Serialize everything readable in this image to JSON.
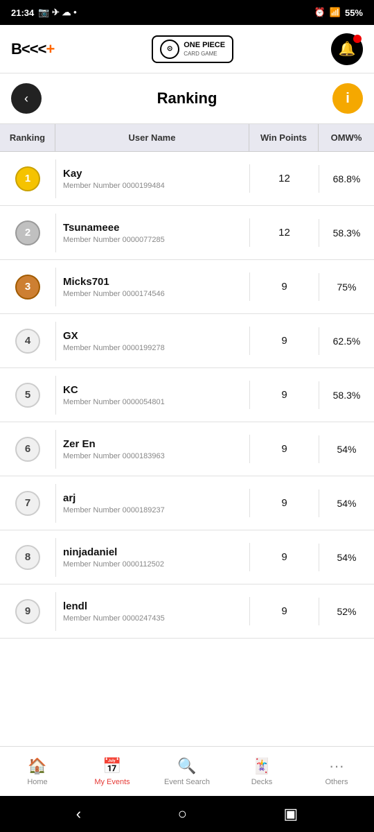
{
  "statusBar": {
    "time": "21:34",
    "battery": "55%",
    "signal": "4G"
  },
  "header": {
    "logoText": "B<<<+",
    "opBrand": "ONE PIECE",
    "opSub": "CARD GAME",
    "bellBadge": true
  },
  "pageHeader": {
    "backLabel": "‹",
    "title": "Ranking",
    "infoLabel": "i"
  },
  "table": {
    "columns": [
      "Ranking",
      "User Name",
      "Win Points",
      "OMW%"
    ],
    "rows": [
      {
        "rank": 1,
        "name": "Kay",
        "member": "Member Number 0000199484",
        "points": 12,
        "omw": "68.8%"
      },
      {
        "rank": 2,
        "name": "Tsunameee",
        "member": "Member Number 0000077285",
        "points": 12,
        "omw": "58.3%"
      },
      {
        "rank": 3,
        "name": "Micks701",
        "member": "Member Number 0000174546",
        "points": 9,
        "omw": "75%"
      },
      {
        "rank": 4,
        "name": "GX",
        "member": "Member Number 0000199278",
        "points": 9,
        "omw": "62.5%"
      },
      {
        "rank": 5,
        "name": "KC",
        "member": "Member Number 0000054801",
        "points": 9,
        "omw": "58.3%"
      },
      {
        "rank": 6,
        "name": "Zer En",
        "member": "Member Number 0000183963",
        "points": 9,
        "omw": "54%"
      },
      {
        "rank": 7,
        "name": "arj",
        "member": "Member Number 0000189237",
        "points": 9,
        "omw": "54%"
      },
      {
        "rank": 8,
        "name": "ninjadaniel",
        "member": "Member Number 0000112502",
        "points": 9,
        "omw": "54%"
      },
      {
        "rank": 9,
        "name": "lendl",
        "member": "Member Number 0000247435",
        "points": 9,
        "omw": "52%"
      }
    ]
  },
  "bottomNav": {
    "items": [
      {
        "id": "home",
        "label": "Home",
        "icon": "🏠",
        "active": false
      },
      {
        "id": "my-events",
        "label": "My Events",
        "icon": "📅",
        "active": true
      },
      {
        "id": "event-search",
        "label": "Event Search",
        "icon": "🔍",
        "active": false
      },
      {
        "id": "decks",
        "label": "Decks",
        "icon": "🃏",
        "active": false
      },
      {
        "id": "others",
        "label": "Others",
        "icon": "···",
        "active": false
      }
    ]
  }
}
